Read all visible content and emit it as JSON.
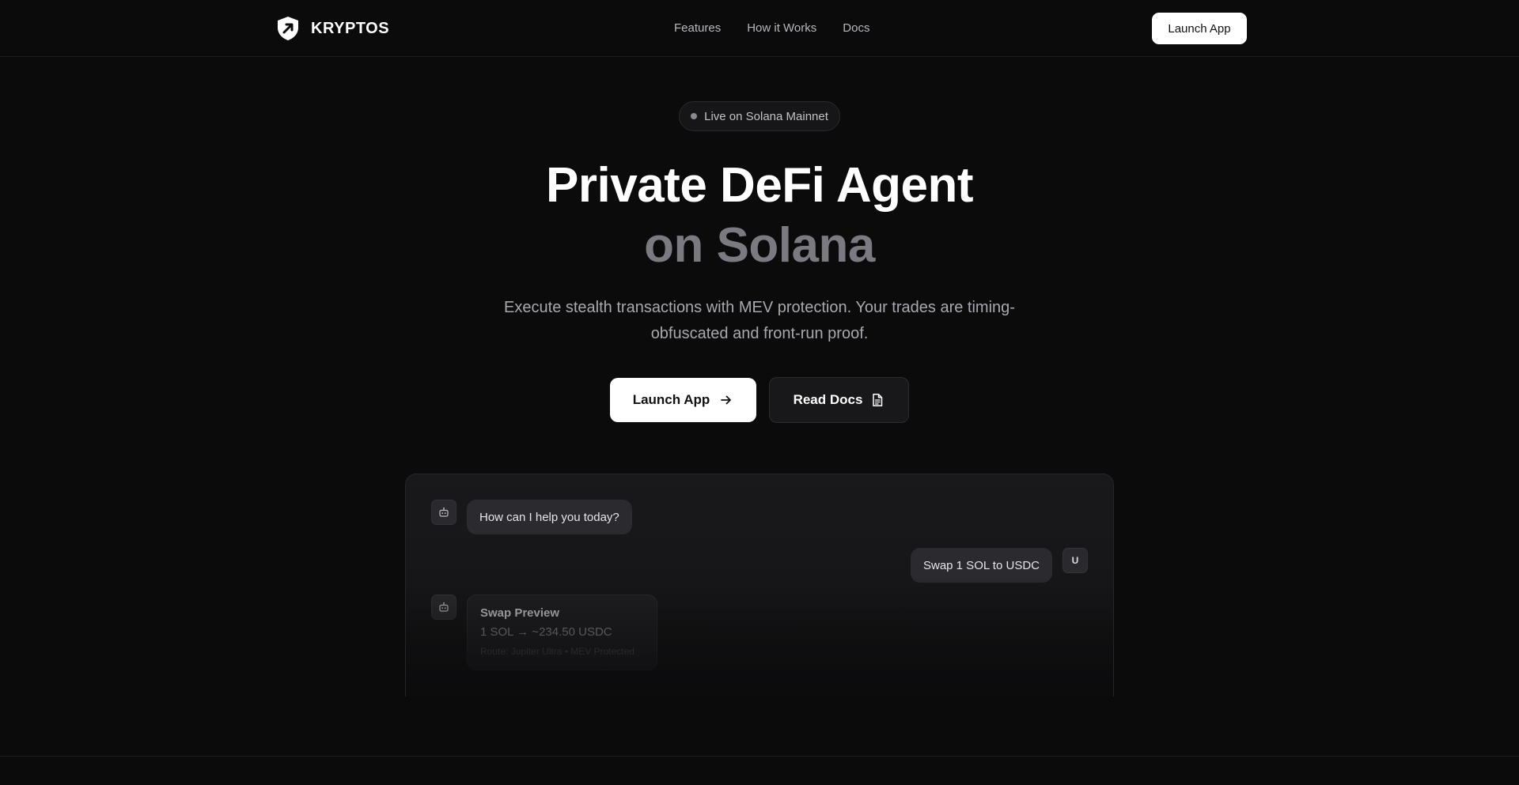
{
  "nav": {
    "brand": "KRYPTOS",
    "links": [
      "Features",
      "How it Works",
      "Docs"
    ],
    "cta": "Launch App"
  },
  "hero": {
    "badge": "Live on Solana Mainnet",
    "title_line1": "Private DeFi Agent",
    "title_line2": "on Solana",
    "subtitle": "Execute stealth transactions with MEV protection. Your trades are timing-obfuscated and front-run proof.",
    "primary_button": "Launch App",
    "secondary_button": "Read Docs"
  },
  "chat": {
    "bot_greeting": "How can I help you today?",
    "user_message": "Swap 1 SOL to USDC",
    "user_avatar": "U",
    "preview": {
      "title": "Swap Preview",
      "amount": "1 SOL → ~234.50 USDC",
      "route": "Route: Jupiter Ultra • MEV Protected"
    }
  },
  "icons": {
    "brand": "shield-icon",
    "primary_button": "arrow-right-icon",
    "secondary_button": "document-icon",
    "bot": "robot-icon"
  }
}
